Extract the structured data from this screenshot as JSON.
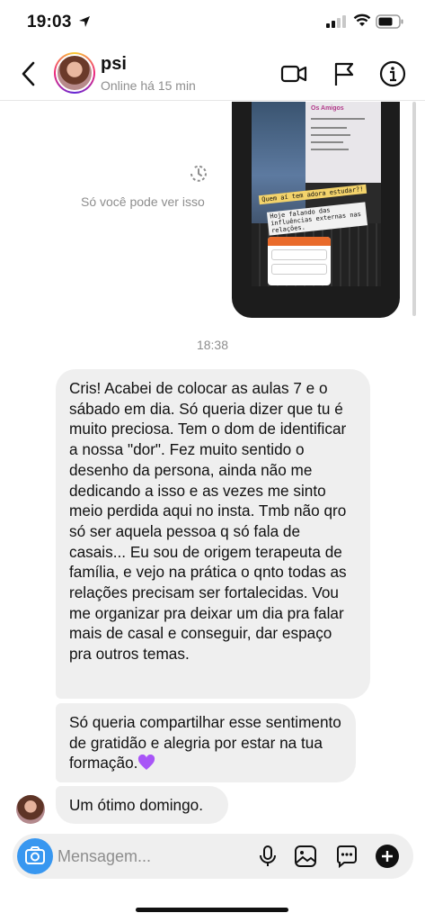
{
  "status_bar": {
    "time": "19:03"
  },
  "header": {
    "name": "psi",
    "presence": "Online há 15 min"
  },
  "story_reply": {
    "view_once_notice": "Só você pode ver isso",
    "caption_top": "Os Amigos",
    "caption_1": "Quem aí tem adora estudar?!",
    "caption_2": "Hoje falando das influências externas nas relações.",
    "poll_title": "AMIGOS PODEM INFLUENCIAR?",
    "poll_options": [
      "Sim, claro",
      "Não, cada um faz suas escolhas"
    ]
  },
  "messages": {
    "timestamp": "18:38",
    "items": [
      {
        "text": "Cris! Acabei de colocar as aulas 7 e o sábado em dia. Só queria dizer que tu é muito preciosa. Tem o dom de identificar a nossa \"dor\". Fez muito sentido o desenho da persona, ainda não me dedicando a isso e as vezes me sinto meio perdida aqui no insta. Tmb não qro só ser aquela pessoa q só fala de casais... Eu sou de origem terapeuta de família, e vejo na prática o qnto todas as relações precisam ser fortalecidas. Vou me organizar pra deixar um dia pra falar mais de casal e conseguir, dar espaço pra outros temas."
      },
      {
        "text": "Só queria compartilhar esse sentimento de gratidão e alegria por estar na tua formação."
      },
      {
        "text": "Um ótimo domingo."
      }
    ]
  },
  "composer": {
    "placeholder": "Mensagem..."
  },
  "icons": {
    "back": "chevron-left-icon",
    "video": "video-camera-icon",
    "report": "flag-icon",
    "info": "info-icon",
    "camera": "camera-icon",
    "mic": "microphone-icon",
    "gallery": "image-icon",
    "sticker": "chat-bubble-icon",
    "more": "plus-icon"
  },
  "colors": {
    "accent": "#3897f0",
    "bubble": "#efefef",
    "heart": "#a855f7"
  }
}
